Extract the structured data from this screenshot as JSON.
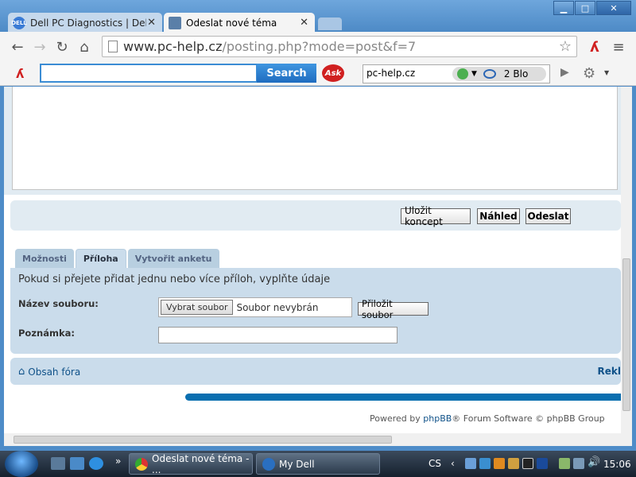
{
  "browser": {
    "tabs": [
      {
        "title": "Dell PC Diagnostics | Dell C",
        "active": false
      },
      {
        "title": "Odeslat nové téma",
        "active": true
      }
    ],
    "address": {
      "domain": "www.pc-help.cz",
      "path": "/posting.php?mode=post&f=7"
    }
  },
  "askbar": {
    "search_button": "Search",
    "logo_text": "Ask",
    "site_field": "pc-help.cz",
    "blocked": "2 Blo"
  },
  "form": {
    "buttons": {
      "save_draft": "Uložit koncept",
      "preview": "Náhled",
      "submit": "Odeslat"
    },
    "tabs": [
      {
        "label": "Možnosti",
        "active": false
      },
      {
        "label": "Příloha",
        "active": true
      },
      {
        "label": "Vytvořit anketu",
        "active": false
      }
    ],
    "attachment": {
      "intro": "Pokud si přejete přidat jednu nebo více příloh, vyplňte údaje",
      "filename_label": "Název souboru:",
      "choose_file": "Vybrat soubor",
      "no_file": "Soubor nevybrán",
      "attach_button": "Přiložit soubor",
      "note_label": "Poznámka:"
    }
  },
  "footer": {
    "home_link": "Obsah fóra",
    "right_link": "Rekl",
    "powered_prefix": "Powered by ",
    "powered_link": "phpBB",
    "powered_suffix": "® Forum Software © phpBB Group"
  },
  "taskbar": {
    "items": [
      {
        "label": "Odeslat nové téma - ..."
      },
      {
        "label": "My Dell"
      }
    ],
    "language": "CS",
    "clock": "15:06"
  }
}
